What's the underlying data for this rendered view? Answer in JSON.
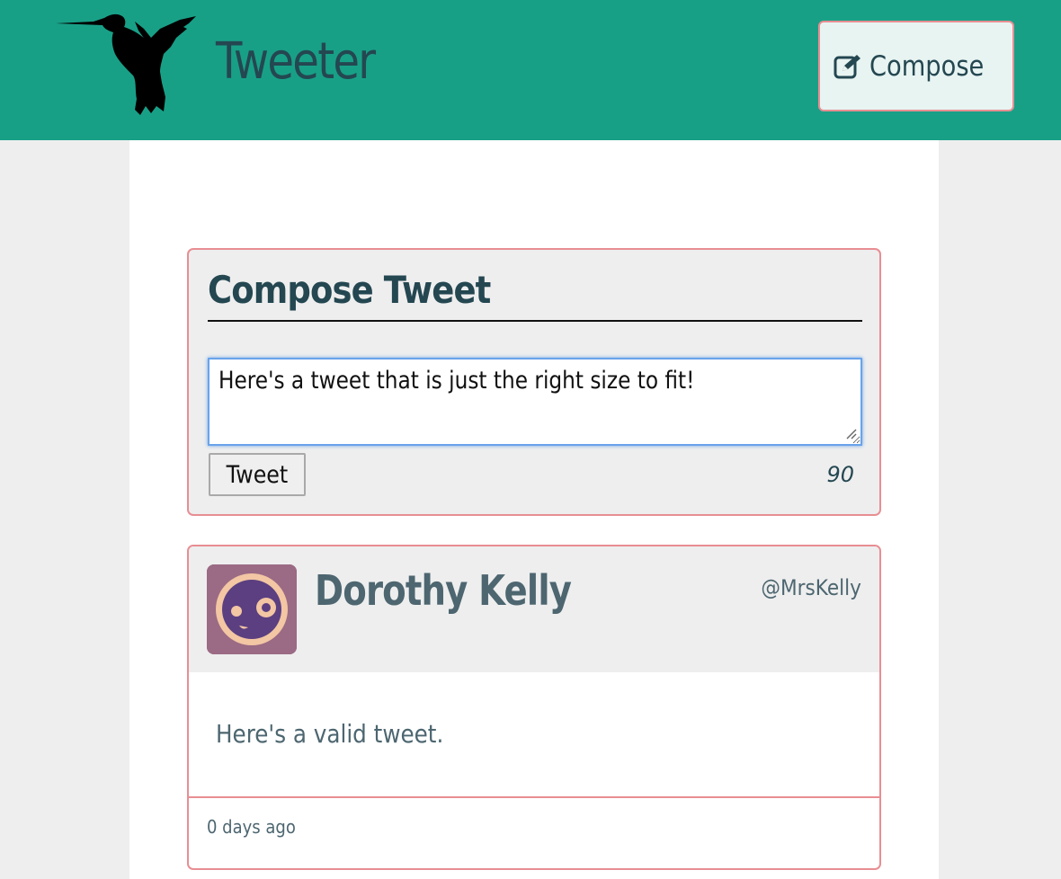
{
  "nav": {
    "brand": "Tweeter",
    "compose_label": "Compose",
    "logo_icon": "hummingbird-icon",
    "compose_icon": "edit-icon"
  },
  "new_tweet": {
    "heading": "Compose Tweet",
    "text_value": "Here's a tweet that is just the right size to fit!",
    "submit_label": "Tweet",
    "char_counter": "90"
  },
  "tweets": [
    {
      "name": "Dorothy Kelly",
      "handle": "@MrsKelly",
      "content": "Here's a valid tweet.",
      "timestamp": "0 days ago",
      "avatar_icon": "face-avatar-icon"
    }
  ],
  "colors": {
    "nav_bg": "#18a087",
    "accent_border": "#e88e93",
    "text_dark": "#244751",
    "text_muted": "#4d6670",
    "page_bg": "#eeeeee"
  }
}
